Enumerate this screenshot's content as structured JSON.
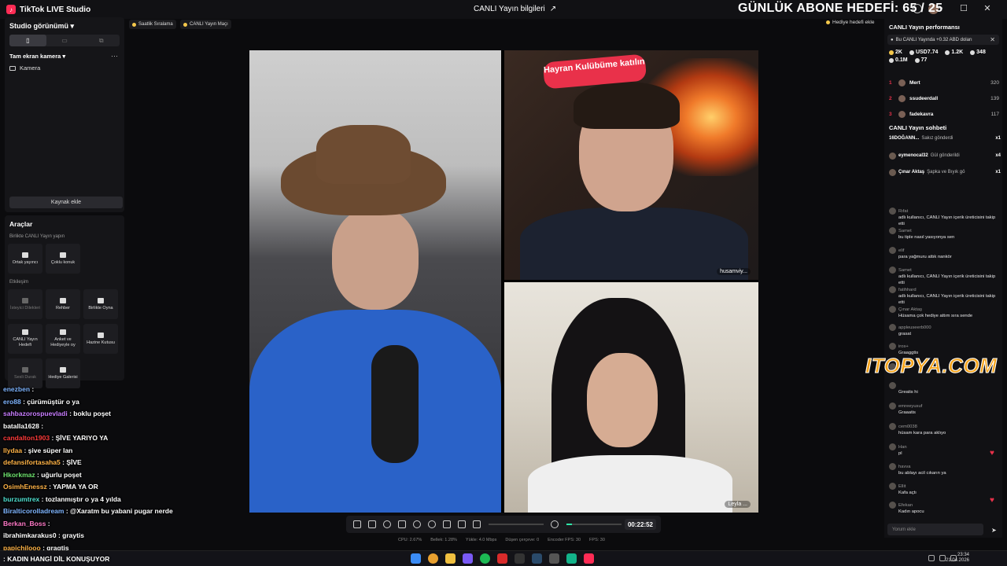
{
  "window": {
    "app_title": "TikTok LIVE Studio",
    "center_title": "CANLI Yayın bilgileri",
    "goal_overlay": "GÜNLÜK ABONE HEDEFİ: 65 / 25",
    "controls": [
      "–",
      "☐",
      "✕"
    ]
  },
  "left": {
    "studio_view": "Studio görünümü",
    "scene_label": "Tam ekran kamera",
    "source_camera": "Kamera",
    "add_source": "Kaynak ekle",
    "tools_title": "Araçlar",
    "section_collab": "Birlikte CANLI Yayın yapın",
    "tile_cohost": "Ortak yayıncı",
    "tile_multi": "Çoklu konuk",
    "section_engagement": "Etkileşim",
    "tile_wishlist": "İsteyici Dilekleri",
    "tile_guide": "Rehber",
    "tile_playtogether": "Birlikte Oyna",
    "tile_goal": "CANLI Yayın Hedefi",
    "tile_poll": "Anket ve Hediyeyle oy",
    "tile_treasure": "Hazine Kutusu",
    "tile_gallery": "Hediye Galerisi",
    "tile_cut": "Sesli Durak"
  },
  "tags": {
    "sorting": "Saatlik Sıralama",
    "match": "CANLI Yayın Maçı",
    "gift_goal": "Hediye hedefi ekle"
  },
  "video": {
    "hayran": "Hayran Kulübüme katılın",
    "label_top": "husamviy...",
    "label_bottom": "Leyla ..."
  },
  "controls_bar": {
    "timer": "00:22:52",
    "volume_level": 0.1
  },
  "stats": {
    "cpu": "CPU: 2.67%",
    "loss": "Bellek: 1.28%",
    "upload": "Yükle: 4.0 Mbps",
    "dropped": "Düşen çerçeve: 0",
    "encoder": "Encoder FPS: 30",
    "fps": "FPS: 30"
  },
  "right": {
    "perf_title": "CANLI Yayın performansı",
    "banner": "Bu CANLI Yayında +0.32 ABD doları",
    "kpis": {
      "likes": "2K",
      "usd": "USD7.74",
      "followers": "1.2K",
      "shares": "348",
      "views": "0.1M",
      "gifts": "77"
    },
    "ranking": [
      {
        "rank": "1",
        "name": "Mert",
        "score": "320"
      },
      {
        "rank": "2",
        "name": "ssudeerdall",
        "score": "139"
      },
      {
        "rank": "3",
        "name": "fadekavra",
        "score": "117"
      }
    ],
    "chat_title": "CANLI Yayın sohbeti",
    "gifts": [
      {
        "user": "16DOĞANN...",
        "action": "Sakız gönderdi",
        "count": "x1"
      },
      {
        "user": "eymenocal32",
        "action": "Gül gönderildi",
        "count": "x4"
      },
      {
        "user": "Çınar Aktaş",
        "action": "Şapka ve Bıyık gö",
        "count": "x1"
      }
    ],
    "comments": [
      {
        "user": "Rıfat",
        "text": "adlı kullanıcı, CANLI Yayın içerik üreticisini takip etti"
      },
      {
        "user": "Samet",
        "text": "bu tiple nasıl yasıyonya sen"
      },
      {
        "user": "elif",
        "text": "para yağmuru attık nankör"
      },
      {
        "user": "Samet",
        "text": "adlı kullanıcı, CANLI Yayın içerik üreticisini takip etti"
      },
      {
        "user": "fatihhard",
        "text": "adlı kullanıcı, CANLI Yayın içerik üreticisini takip etti"
      },
      {
        "user": "Çınar Aktaş",
        "text": "Hüsama çok hediye attım sıra sende"
      },
      {
        "user": "appleuseerb000",
        "text": "grasat"
      },
      {
        "user": "iros+",
        "text": "Graaggtis"
      },
      {
        "user": "Tuğba",
        "text": ""
      },
      {
        "user": "",
        "text": "Greatis hi"
      },
      {
        "user": "emreeyusuf",
        "text": "Graaatis"
      },
      {
        "user": "cem0038",
        "text": "hüsam kara para aklıyo"
      },
      {
        "user": "Han",
        "text": "pl"
      },
      {
        "user": "havva",
        "text": "bu ablayı acil cıkarın ya"
      },
      {
        "user": "Ellit",
        "text": "Kafa açtı"
      },
      {
        "user": "Efekan",
        "text": "Kadın apocu"
      },
      {
        "user": "m228c437",
        "text": "CANLI Yayını beğendi"
      }
    ],
    "chat_placeholder": "Yorum ekle"
  },
  "watermark": "ITOPYA.COM",
  "overlay_chat": [
    {
      "user": "enezben",
      "msg": ":",
      "color": "#7fb5ff"
    },
    {
      "user": "ero88",
      "msg": ": çürümüştür o ya",
      "color": "#7fb5ff"
    },
    {
      "user": "sahbazorospuevladi",
      "msg": ": boklu poşet",
      "color": "#c87dff"
    },
    {
      "user": "batalla1628",
      "msg": ":",
      "color": "#ffffff"
    },
    {
      "user": "candalton1903",
      "msg": ": ŞİVE YARIYO YA",
      "color": "#ff3b3b"
    },
    {
      "user": "llydaa",
      "msg": ": şive süper lan",
      "color": "#ffb347"
    },
    {
      "user": "defansifortasaha5",
      "msg": ": ŞİVE",
      "color": "#ffb347"
    },
    {
      "user": "Hkorkmaz",
      "msg": ": uğurlu poşet",
      "color": "#6fe36f"
    },
    {
      "user": "OsimhEnessz",
      "msg": ": YAPMA YA OR",
      "color": "#ffb347"
    },
    {
      "user": "burzumtrex",
      "msg": ": tozlanmıştır o ya 4 yılda",
      "color": "#4fe0d0"
    },
    {
      "user": "Biralticorolladream",
      "msg": ": @Xaratm bu yabani pugar nerde",
      "color": "#7fb5ff"
    },
    {
      "user": "Berkan_Boss",
      "msg": ":",
      "color": "#ff7ac8"
    },
    {
      "user": "ibrahimkarakus0",
      "msg": ": graytis",
      "color": "#ffffff"
    },
    {
      "user": "papichilooo",
      "msg": ": gragtis",
      "color": "#ffb347"
    }
  ],
  "bottom_caption": ": KADIN HANGİ DİL KONUŞUYOR",
  "taskbar": {
    "time": "23:34",
    "date": "21.04.2026"
  }
}
